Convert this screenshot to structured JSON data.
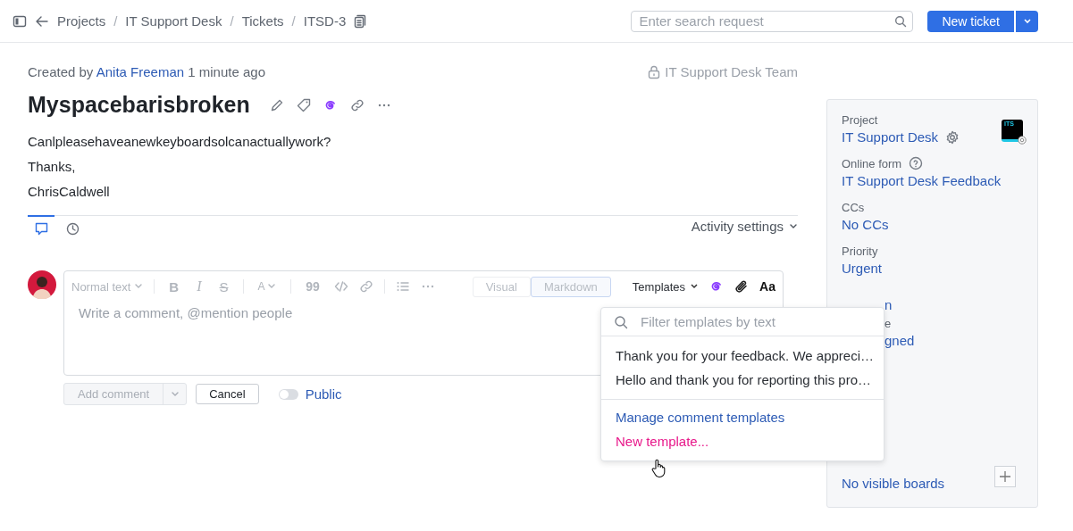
{
  "breadcrumb": [
    "Projects",
    "IT Support Desk",
    "Tickets",
    "ITSD-3"
  ],
  "breadcrumb_separator": "/",
  "search": {
    "placeholder": "Enter search request"
  },
  "new_ticket_button": "New ticket",
  "meta": {
    "prefix": "Created by",
    "author": "Anita Freeman",
    "time": "1 minute ago"
  },
  "visibility": "IT Support Desk Team",
  "title": "Myspacebarisbroken",
  "description": [
    "Canlpleasehaveanewkeyboardsolcanactuallywork?",
    "Thanks,",
    "ChrisCaldwell"
  ],
  "activity_tabs": [
    {
      "kind": "comments",
      "selected": true
    },
    {
      "kind": "history",
      "selected": false
    }
  ],
  "activity_settings": "Activity settings",
  "editor": {
    "style": "Normal text",
    "format_buttons": [
      {
        "kind": "bold",
        "glyph": "B"
      },
      {
        "kind": "italic",
        "glyph": "I"
      },
      {
        "kind": "strike",
        "glyph": "S"
      },
      {
        "kind": "color",
        "glyph": "A"
      },
      {
        "kind": "quote",
        "glyph": "99"
      }
    ],
    "modes": [
      {
        "label": "Visual",
        "selected": false
      },
      {
        "label": "Markdown",
        "selected": true
      }
    ],
    "templates": "Templates",
    "font_button": "Aa",
    "placeholder": "Write a comment, @mention people"
  },
  "actions": {
    "add": "Add comment",
    "cancel": "Cancel",
    "public": {
      "label": "Public",
      "on": false
    }
  },
  "templates_menu": {
    "placeholder": "Filter templates by text",
    "templates": [
      "Thank you for your feedback. We appreci…",
      "Hello and thank you for reporting this pro…"
    ],
    "links": [
      {
        "label": "Manage comment templates",
        "hovered": false
      },
      {
        "label": "New template...",
        "hovered": true
      }
    ]
  },
  "sidebar": {
    "logo": "ITS",
    "fields": [
      {
        "kind": "project",
        "label": "Project",
        "value": "IT Support Desk"
      },
      {
        "kind": "help",
        "label": "Online form",
        "value": "IT Support Desk Feedback"
      },
      {
        "kind": "plain",
        "label": "CCs",
        "value": "No CCs"
      },
      {
        "kind": "plain",
        "label": "Priority",
        "value": "Urgent"
      },
      {
        "kind": "clipped",
        "value": "n"
      },
      {
        "kind": "clipped",
        "label": "e",
        "value": "gned"
      }
    ],
    "boards": "No visible boards"
  }
}
